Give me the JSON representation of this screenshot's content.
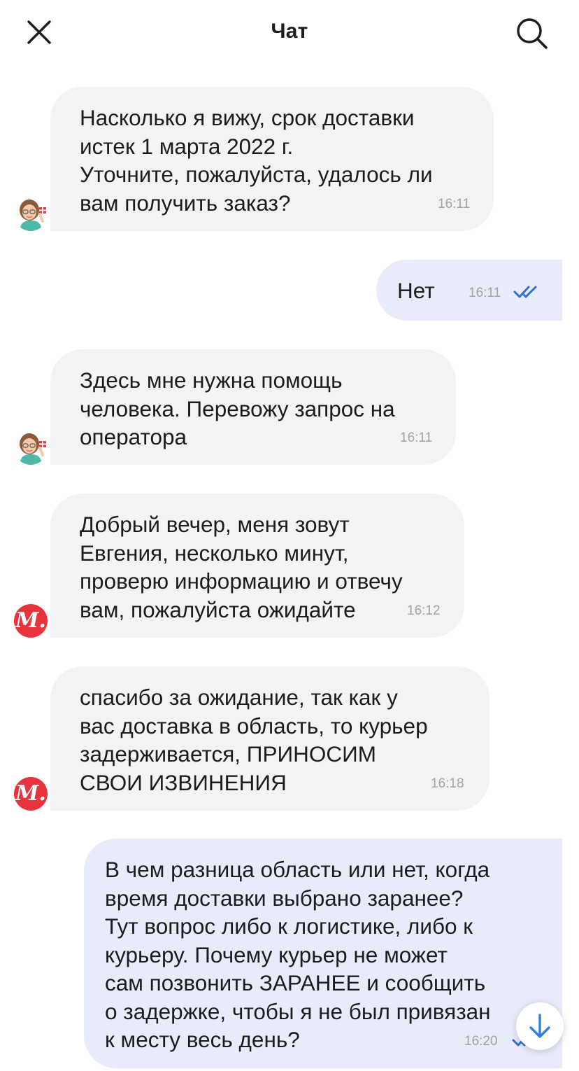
{
  "header": {
    "title": "Чат",
    "close_icon": "close-icon",
    "search_icon": "search-icon"
  },
  "messages": [
    {
      "direction": "incoming",
      "sender": "bot",
      "text": "Насколько я вижу, срок доставки\nистек 1 марта 2022 г.\nУточните, пожалуйста, удалось ли\nвам получить заказ?",
      "time": "16:11"
    },
    {
      "direction": "outgoing",
      "text": "Нет",
      "time": "16:11",
      "status": "read"
    },
    {
      "direction": "incoming",
      "sender": "bot",
      "text": "Здесь мне нужна помощь\nчеловека. Перевожу запрос на\nоператора",
      "time": "16:11"
    },
    {
      "direction": "incoming",
      "sender": "operator",
      "text": "Добрый вечер, меня зовут\nЕвгения, несколько минут,\nпроверю информацию и отвечу\nвам, пожалуйста ожидайте",
      "time": "16:12"
    },
    {
      "direction": "incoming",
      "sender": "operator",
      "text": "спасибо за ожидание, так как у\nвас доставка в область, то курьер\nзадерживается, ПРИНОСИМ\nСВОИ ИЗВИНЕНИЯ",
      "time": "16:18"
    },
    {
      "direction": "outgoing",
      "text": "В чем разница область или нет, когда\nвремя доставки выбрано заранее?\nТут вопрос либо к логистике, либо к\nкурьеру. Почему курьер не может\nсам позвонить ЗАРАНЕЕ и сообщить\nо задержке, чтобы я не был привязан\nк месту весь день?",
      "time": "16:20",
      "status": "read"
    }
  ],
  "avatars": {
    "bot_icon": "assistant-girl-avatar-icon",
    "operator_label": "М.",
    "operator_color": "#e8333c"
  },
  "colors": {
    "incoming_bubble": "#f3f3f4",
    "outgoing_bubble": "#e8ecfa",
    "read_check": "#2f6fd6"
  },
  "scroll_button_icon": "arrow-down-icon"
}
